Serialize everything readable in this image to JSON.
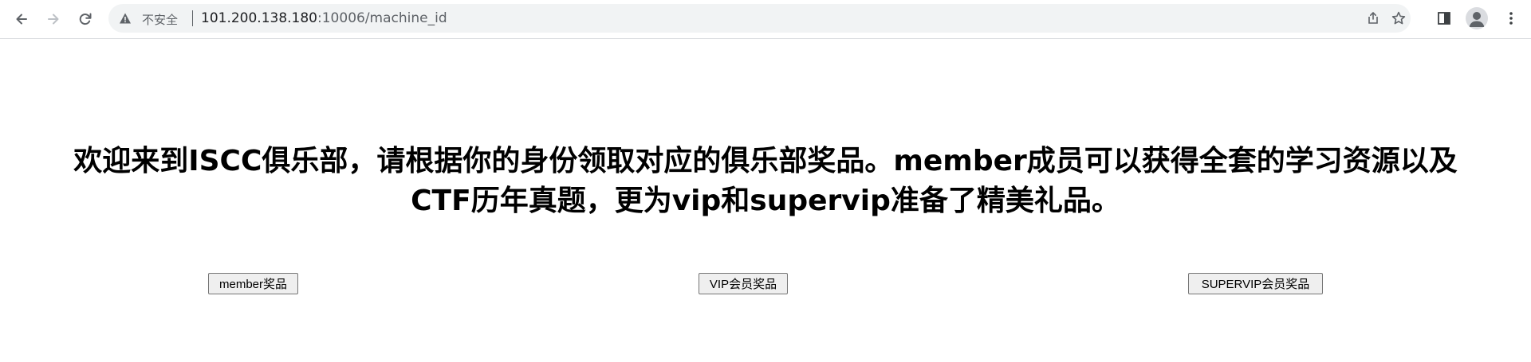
{
  "browser": {
    "back_icon": "arrow-left-icon",
    "forward_icon": "arrow-right-icon",
    "reload_icon": "reload-icon",
    "security_label": "不安全",
    "url_host": "101.200.138.180",
    "url_rest": ":10006/machine_id",
    "share_icon": "share-icon",
    "bookmark_icon": "star-icon",
    "sidepanel_icon": "side-panel-icon",
    "profile_icon": "avatar-icon",
    "menu_icon": "kebab-menu-icon"
  },
  "page": {
    "heading_line1": "欢迎来到ISCC俱乐部，请根据你的身份领取对应的俱乐部奖品。member成员可以获得全套的学习资源以及",
    "heading_line2": "CTF历年真题，更为vip和supervip准备了精美礼品。",
    "buttons": {
      "member": "member奖品",
      "vip": "VIP会员奖品",
      "supervip": "SUPERVIP会员奖品"
    }
  }
}
